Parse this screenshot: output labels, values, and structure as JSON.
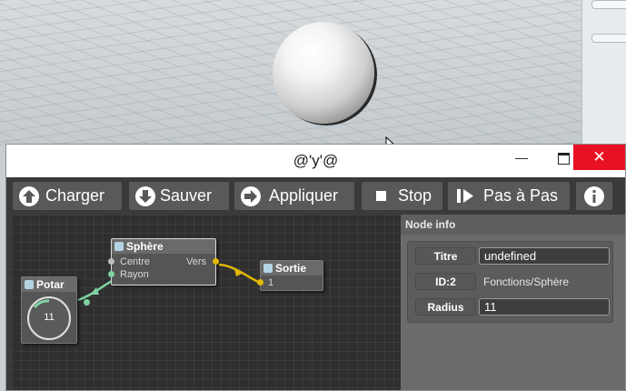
{
  "window": {
    "title": "@'y'@",
    "minimize_label": "—",
    "close_label": "✕"
  },
  "toolbar": {
    "load_label": "Charger",
    "save_label": "Sauver",
    "apply_label": "Appliquer",
    "stop_label": "Stop",
    "step_label": "Pas à Pas"
  },
  "graph": {
    "nodes": {
      "potar": {
        "title": "Potar",
        "value": "11"
      },
      "sphere": {
        "title": "Sphère",
        "input_center": "Centre",
        "input_radius": "Rayon",
        "output": "Vers"
      },
      "sortie": {
        "title": "Sortie",
        "input": "1"
      }
    }
  },
  "info": {
    "header": "Node info",
    "title_key": "Titre",
    "title_value": "undefined",
    "id_key": "ID:2",
    "id_value": "Fonctions/Sphère",
    "radius_key": "Radius",
    "radius_value": "11"
  },
  "colors": {
    "accent_green": "#7fd3a2",
    "accent_yellow": "#e2b900",
    "close_red": "#e81123"
  }
}
